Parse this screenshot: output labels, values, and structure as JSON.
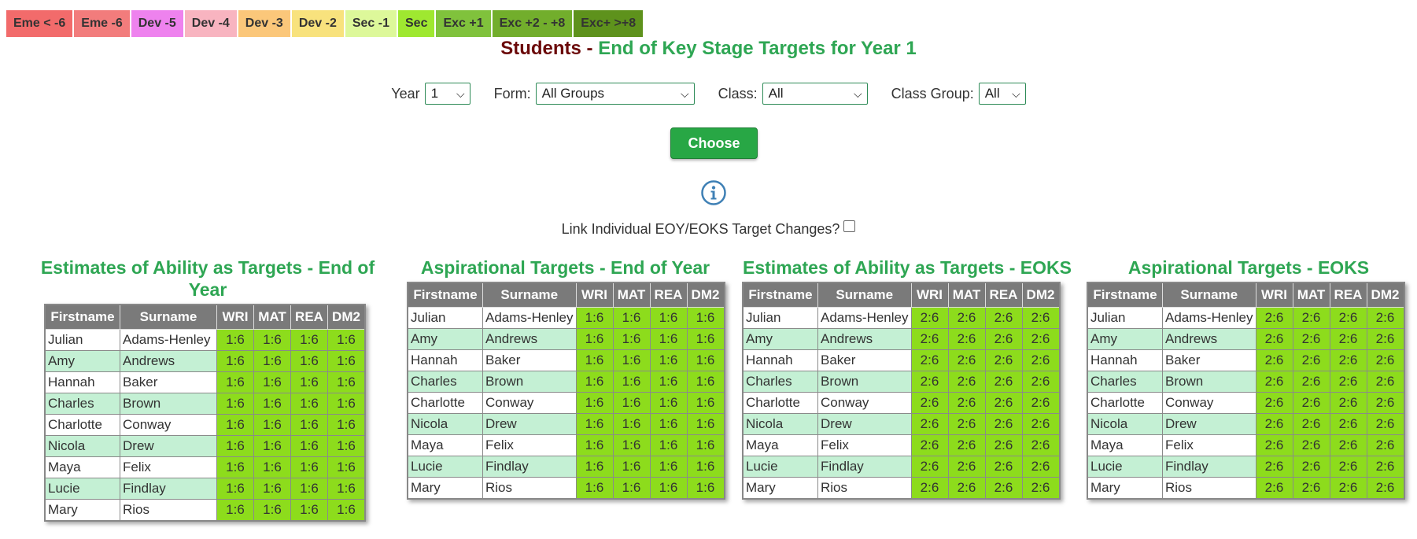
{
  "legend": [
    {
      "label": "Eme < -6",
      "color": "#f26b6b"
    },
    {
      "label": "Eme -6",
      "color": "#f27c7c"
    },
    {
      "label": "Dev -5",
      "color": "#ee82ee"
    },
    {
      "label": "Dev -4",
      "color": "#f8b4c0"
    },
    {
      "label": "Dev -3",
      "color": "#fbc77a"
    },
    {
      "label": "Dev -2",
      "color": "#f8e27d"
    },
    {
      "label": "Sec -1",
      "color": "#ddf89a"
    },
    {
      "label": "Sec",
      "color": "#9fe830"
    },
    {
      "label": "Exc +1",
      "color": "#80c23c"
    },
    {
      "label": "Exc +2 - +8",
      "color": "#72ae2c"
    },
    {
      "label": "Exc+ >+8",
      "color": "#5e921c"
    }
  ],
  "title": {
    "part1": "Students",
    "separator": " - ",
    "part2": "End of Key Stage Targets for Year 1"
  },
  "filters": {
    "year": {
      "label": "Year",
      "value": "1"
    },
    "form": {
      "label": "Form:",
      "value": "All Groups"
    },
    "class": {
      "label": "Class:",
      "value": "All"
    },
    "class_group": {
      "label": "Class Group:",
      "value": "All"
    }
  },
  "choose_label": "Choose",
  "link_label": "Link Individual EOY/EOKS Target Changes?",
  "columns": [
    "Firstname",
    "Surname",
    "WRI",
    "MAT",
    "REA",
    "DM2"
  ],
  "panels": [
    {
      "title": "Estimates of Ability as Targets - End of Year",
      "rows": [
        {
          "first": "Julian",
          "last": "Adams-Henley",
          "t": [
            "1:6",
            "1:6",
            "1:6",
            "1:6"
          ]
        },
        {
          "first": "Amy",
          "last": "Andrews",
          "t": [
            "1:6",
            "1:6",
            "1:6",
            "1:6"
          ]
        },
        {
          "first": "Hannah",
          "last": "Baker",
          "t": [
            "1:6",
            "1:6",
            "1:6",
            "1:6"
          ]
        },
        {
          "first": "Charles",
          "last": "Brown",
          "t": [
            "1:6",
            "1:6",
            "1:6",
            "1:6"
          ]
        },
        {
          "first": "Charlotte",
          "last": "Conway",
          "t": [
            "1:6",
            "1:6",
            "1:6",
            "1:6"
          ]
        },
        {
          "first": "Nicola",
          "last": "Drew",
          "t": [
            "1:6",
            "1:6",
            "1:6",
            "1:6"
          ]
        },
        {
          "first": "Maya",
          "last": "Felix",
          "t": [
            "1:6",
            "1:6",
            "1:6",
            "1:6"
          ]
        },
        {
          "first": "Lucie",
          "last": "Findlay",
          "t": [
            "1:6",
            "1:6",
            "1:6",
            "1:6"
          ]
        },
        {
          "first": "Mary",
          "last": "Rios",
          "t": [
            "1:6",
            "1:6",
            "1:6",
            "1:6"
          ]
        }
      ]
    },
    {
      "title": "Aspirational Targets - End of Year",
      "rows": [
        {
          "first": "Julian",
          "last": "Adams-Henley",
          "t": [
            "1:6",
            "1:6",
            "1:6",
            "1:6"
          ]
        },
        {
          "first": "Amy",
          "last": "Andrews",
          "t": [
            "1:6",
            "1:6",
            "1:6",
            "1:6"
          ]
        },
        {
          "first": "Hannah",
          "last": "Baker",
          "t": [
            "1:6",
            "1:6",
            "1:6",
            "1:6"
          ]
        },
        {
          "first": "Charles",
          "last": "Brown",
          "t": [
            "1:6",
            "1:6",
            "1:6",
            "1:6"
          ]
        },
        {
          "first": "Charlotte",
          "last": "Conway",
          "t": [
            "1:6",
            "1:6",
            "1:6",
            "1:6"
          ]
        },
        {
          "first": "Nicola",
          "last": "Drew",
          "t": [
            "1:6",
            "1:6",
            "1:6",
            "1:6"
          ]
        },
        {
          "first": "Maya",
          "last": "Felix",
          "t": [
            "1:6",
            "1:6",
            "1:6",
            "1:6"
          ]
        },
        {
          "first": "Lucie",
          "last": "Findlay",
          "t": [
            "1:6",
            "1:6",
            "1:6",
            "1:6"
          ]
        },
        {
          "first": "Mary",
          "last": "Rios",
          "t": [
            "1:6",
            "1:6",
            "1:6",
            "1:6"
          ]
        }
      ]
    },
    {
      "title": "Estimates of Ability as Targets - EOKS",
      "rows": [
        {
          "first": "Julian",
          "last": "Adams-Henley",
          "t": [
            "2:6",
            "2:6",
            "2:6",
            "2:6"
          ]
        },
        {
          "first": "Amy",
          "last": "Andrews",
          "t": [
            "2:6",
            "2:6",
            "2:6",
            "2:6"
          ]
        },
        {
          "first": "Hannah",
          "last": "Baker",
          "t": [
            "2:6",
            "2:6",
            "2:6",
            "2:6"
          ]
        },
        {
          "first": "Charles",
          "last": "Brown",
          "t": [
            "2:6",
            "2:6",
            "2:6",
            "2:6"
          ]
        },
        {
          "first": "Charlotte",
          "last": "Conway",
          "t": [
            "2:6",
            "2:6",
            "2:6",
            "2:6"
          ]
        },
        {
          "first": "Nicola",
          "last": "Drew",
          "t": [
            "2:6",
            "2:6",
            "2:6",
            "2:6"
          ]
        },
        {
          "first": "Maya",
          "last": "Felix",
          "t": [
            "2:6",
            "2:6",
            "2:6",
            "2:6"
          ]
        },
        {
          "first": "Lucie",
          "last": "Findlay",
          "t": [
            "2:6",
            "2:6",
            "2:6",
            "2:6"
          ]
        },
        {
          "first": "Mary",
          "last": "Rios",
          "t": [
            "2:6",
            "2:6",
            "2:6",
            "2:6"
          ]
        }
      ]
    },
    {
      "title": "Aspirational Targets - EOKS",
      "rows": [
        {
          "first": "Julian",
          "last": "Adams-Henley",
          "t": [
            "2:6",
            "2:6",
            "2:6",
            "2:6"
          ]
        },
        {
          "first": "Amy",
          "last": "Andrews",
          "t": [
            "2:6",
            "2:6",
            "2:6",
            "2:6"
          ]
        },
        {
          "first": "Hannah",
          "last": "Baker",
          "t": [
            "2:6",
            "2:6",
            "2:6",
            "2:6"
          ]
        },
        {
          "first": "Charles",
          "last": "Brown",
          "t": [
            "2:6",
            "2:6",
            "2:6",
            "2:6"
          ]
        },
        {
          "first": "Charlotte",
          "last": "Conway",
          "t": [
            "2:6",
            "2:6",
            "2:6",
            "2:6"
          ]
        },
        {
          "first": "Nicola",
          "last": "Drew",
          "t": [
            "2:6",
            "2:6",
            "2:6",
            "2:6"
          ]
        },
        {
          "first": "Maya",
          "last": "Felix",
          "t": [
            "2:6",
            "2:6",
            "2:6",
            "2:6"
          ]
        },
        {
          "first": "Lucie",
          "last": "Findlay",
          "t": [
            "2:6",
            "2:6",
            "2:6",
            "2:6"
          ]
        },
        {
          "first": "Mary",
          "last": "Rios",
          "t": [
            "2:6",
            "2:6",
            "2:6",
            "2:6"
          ]
        }
      ]
    }
  ]
}
